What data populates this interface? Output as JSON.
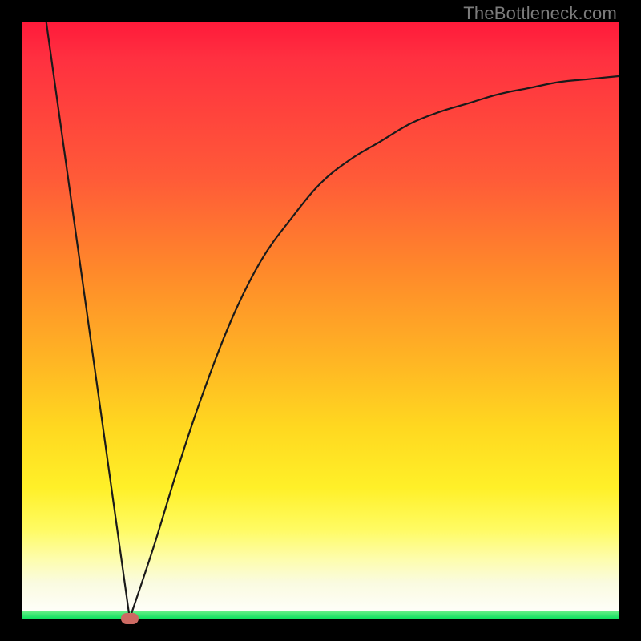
{
  "watermark": "TheBottleneck.com",
  "colors": {
    "frame": "#000000",
    "curve_stroke": "#1a1a1a",
    "marker": "#cd6a63",
    "green_strip_top": "#6ef08a",
    "green_strip_bottom": "#0fe060"
  },
  "chart_data": {
    "type": "line",
    "title": "",
    "xlabel": "",
    "ylabel": "",
    "xlim": [
      0,
      100
    ],
    "ylim": [
      0,
      100
    ],
    "grid": false,
    "legend": false,
    "background": "red-orange-yellow-green vertical gradient",
    "series": [
      {
        "name": "branch-left",
        "description": "steep descending straight segment from top-left to minimum",
        "x": [
          4,
          18
        ],
        "y": [
          100,
          0
        ]
      },
      {
        "name": "branch-right",
        "description": "concave-increasing curve from minimum toward upper-right asymptote",
        "x": [
          18,
          22,
          26,
          30,
          35,
          40,
          45,
          50,
          55,
          60,
          65,
          70,
          75,
          80,
          85,
          90,
          95,
          100
        ],
        "y": [
          0,
          12,
          25,
          37,
          50,
          60,
          67,
          73,
          77,
          80,
          83,
          85,
          86.5,
          88,
          89,
          90,
          90.5,
          91
        ]
      }
    ],
    "minimum_marker": {
      "x": 18,
      "y": 0,
      "shape": "rounded-pill",
      "color": "#cd6a63"
    }
  }
}
